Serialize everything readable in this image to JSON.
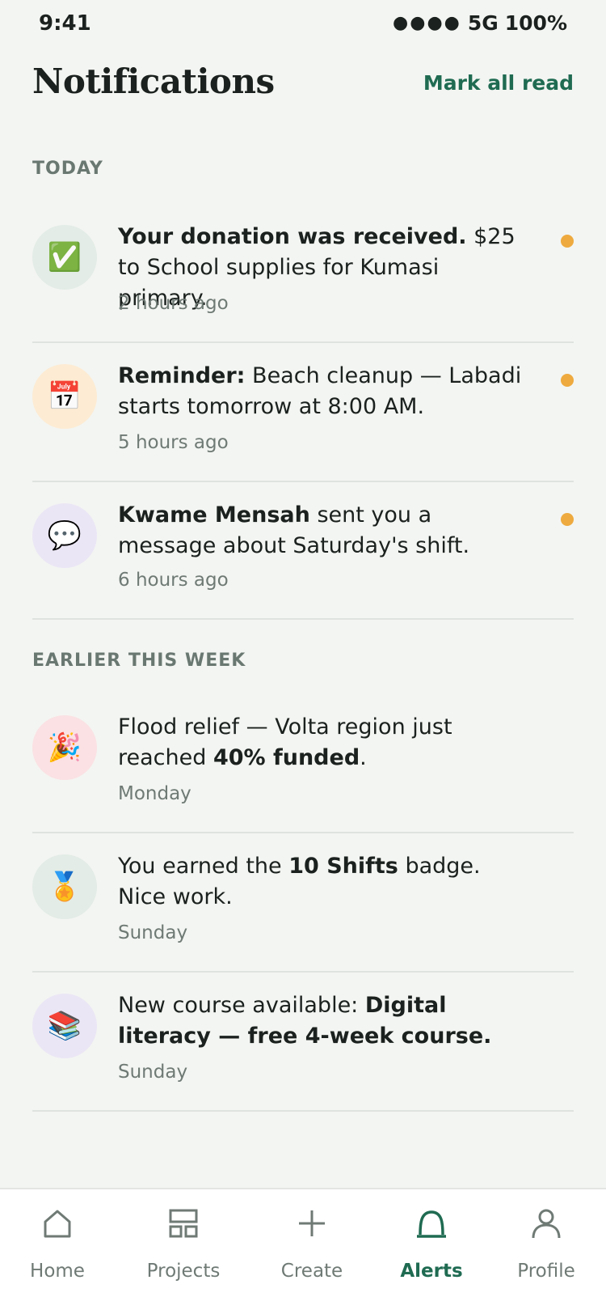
{
  "status_bar": {
    "time": "9:41",
    "signal": "●●●●",
    "network": "5G",
    "battery": "100%"
  },
  "header": {
    "title": "Notifications",
    "mark_all_read": "Mark all read"
  },
  "sections": {
    "today": "TODAY",
    "earlier": "EARLIER THIS WEEK"
  },
  "notifications": [
    {
      "icon": "check-mark-icon",
      "glyph": "✅",
      "bold": "Your donation was received.",
      "text": " $25 to School supplies for Kumasi primary.",
      "time": "2 hours ago",
      "unread": true
    },
    {
      "icon": "calendar-icon",
      "glyph": "📅",
      "bold": "Reminder:",
      "text": " Beach cleanup — Labadi starts tomorrow at 8:00 AM.",
      "time": "5 hours ago",
      "unread": true
    },
    {
      "icon": "speech-bubble-icon",
      "glyph": "💬",
      "bold": "Kwame Mensah",
      "text": " sent you a message about Saturday's shift.",
      "time": "6 hours ago",
      "unread": true
    },
    {
      "icon": "party-popper-icon",
      "glyph": "🎉",
      "pre": "Flood relief — Volta region just reached ",
      "bold": "40% funded",
      "post": ".",
      "time": "Monday",
      "unread": false
    },
    {
      "icon": "medal-icon",
      "glyph": "🏅",
      "pre": "You earned the ",
      "bold": "10 Shifts",
      "post": " badge. Nice work.",
      "time": "Sunday",
      "unread": false
    },
    {
      "icon": "books-icon",
      "glyph": "📚",
      "pre": "New course available: ",
      "bold": "Digital literacy — free 4-week course.",
      "post": "",
      "time": "Sunday",
      "unread": false
    }
  ],
  "nav": [
    {
      "label": "Home",
      "icon": "home-icon",
      "active": false
    },
    {
      "label": "Projects",
      "icon": "grid-icon",
      "active": false
    },
    {
      "label": "Create",
      "icon": "plus-icon",
      "active": false
    },
    {
      "label": "Alerts",
      "icon": "bell-icon",
      "active": true
    },
    {
      "label": "Profile",
      "icon": "person-icon",
      "active": false
    }
  ],
  "colors": {
    "accent": "#1f6b52",
    "unread_dot": "#eeaa3f",
    "background": "#f3f5f2"
  }
}
